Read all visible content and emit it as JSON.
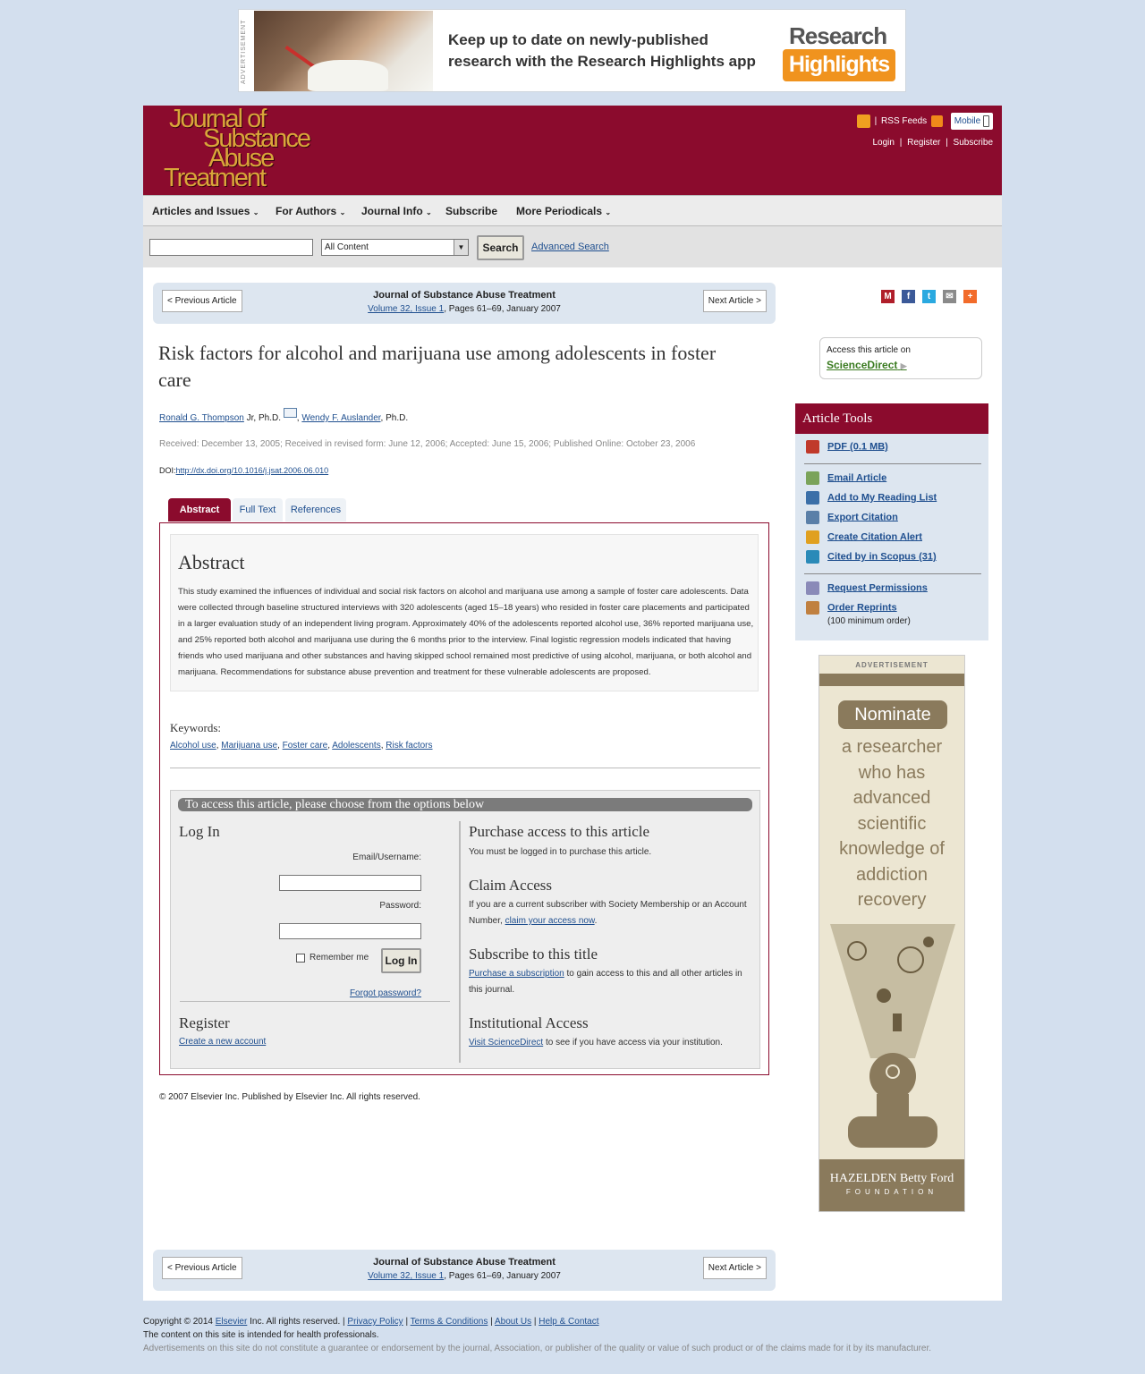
{
  "top_ad": {
    "label": "ADVERTISEMENT",
    "message": "Keep up to date on newly-published research with the Research Highlights app",
    "brand_line1": "Research",
    "brand_line2": "Highlights"
  },
  "header": {
    "logo": [
      "Journal of",
      "Substance",
      "Abuse",
      "Treatment"
    ],
    "rss": "RSS Feeds",
    "mobile": "Mobile",
    "login": "Login",
    "register": "Register",
    "subscribe": "Subscribe"
  },
  "nav": [
    "Articles and Issues",
    "For Authors",
    "Journal Info",
    "Subscribe",
    "More Periodicals"
  ],
  "search": {
    "select_value": "All Content",
    "button": "Search",
    "advanced": "Advanced Search"
  },
  "article_nav": {
    "prev": "< Previous Article",
    "next": "Next Article >",
    "journal": "Journal of Substance Abuse Treatment",
    "volume": "Volume 32, Issue 1",
    "pages": ", Pages 61–69, January 2007"
  },
  "article": {
    "title": "Risk factors for alcohol and marijuana use among adolescents in foster care",
    "author1": "Ronald G. Thompson",
    "author1_suffix": " Jr, Ph.D.",
    "author2": "Wendy F. Auslander",
    "author2_suffix": ", Ph.D.",
    "dates": "Received: December 13, 2005; Received in revised form: June 12, 2006; Accepted: June 15, 2006; Published Online: October 23, 2006",
    "doi_label": "DOI:",
    "doi": "http://dx.doi.org/10.1016/j.jsat.2006.06.010",
    "tabs": [
      "Abstract",
      "Full Text",
      "References"
    ],
    "abstract_heading": "Abstract",
    "abstract": "This study examined the influences of individual and social risk factors on alcohol and marijuana use among a sample of foster care adolescents. Data were collected through baseline structured interviews with 320 adolescents (aged 15–18 years) who resided in foster care placements and participated in a larger evaluation study of an independent living program. Approximately 40% of the adolescents reported alcohol use, 36% reported marijuana use, and 25% reported both alcohol and marijuana use during the 6 months prior to the interview. Final logistic regression models indicated that having friends who used marijuana and other substances and having skipped school remained most predictive of using alcohol, marijuana, or both alcohol and marijuana. Recommendations for substance abuse prevention and treatment for these vulnerable adolescents are proposed.",
    "keywords_label": "Keywords:",
    "keywords": [
      "Alcohol use",
      "Marijuana use",
      "Foster care",
      "Adolescents",
      "Risk factors"
    ],
    "copyright": "© 2007 Elsevier Inc. Published by Elsevier Inc. All rights reserved."
  },
  "access": {
    "bar": "To access this article, please choose from the options below",
    "login_heading": "Log In",
    "email_label": "Email/Username:",
    "password_label": "Password:",
    "remember": "Remember me",
    "login_button": "Log In",
    "forgot": "Forgot password?",
    "register_heading": "Register",
    "create_account": "Create a new account",
    "purchase_heading": "Purchase access to this article",
    "purchase_text": "You must be logged in to purchase this article.",
    "claim_heading": "Claim Access",
    "claim_text": "If you are a current subscriber with Society Membership or an Account Number, ",
    "claim_link": "claim your access now",
    "subscribe_heading": "Subscribe to this title",
    "subscribe_link": "Purchase a subscription",
    "subscribe_text": " to gain access to this and all other articles in this journal.",
    "institutional_heading": "Institutional Access",
    "institutional_link": "Visit ScienceDirect",
    "institutional_text": " to see if you have access via your institution."
  },
  "sidebar": {
    "sd_label": "Access this article on",
    "sd_link": "ScienceDirect",
    "tools_heading": "Article Tools",
    "tools": [
      "PDF (0.1 MB)",
      "Email Article",
      "Add to My Reading List",
      "Export Citation",
      "Create Citation Alert",
      "Cited by in Scopus (31)",
      "Request Permissions",
      "Order Reprints"
    ],
    "reprints_note": "(100 minimum order)"
  },
  "side_ad": {
    "label": "ADVERTISEMENT",
    "nominate": "Nominate",
    "text": [
      "a researcher",
      "who has",
      "advanced",
      "scientific",
      "knowledge of",
      "addiction",
      "recovery"
    ],
    "org1": "HAZELDEN Betty Ford",
    "org2": "FOUNDATION"
  },
  "footer": {
    "copyright": "Copyright © 2014 ",
    "elsevier": "Elsevier",
    "rights": " Inc. All rights reserved. | ",
    "privacy": "Privacy Policy",
    "terms": "Terms & Conditions",
    "about": "About Us",
    "help": "Help & Contact",
    "line2": "The content on this site is intended for health professionals.",
    "line3": "Advertisements on this site do not constitute a guarantee or endorsement by the journal, Association, or publisher of the quality or value of such product or of the claims made for it by its manufacturer."
  },
  "colors": {
    "brand": "#8b0b2d",
    "link": "#1f4f8f",
    "page_bg": "#d3dfee"
  }
}
